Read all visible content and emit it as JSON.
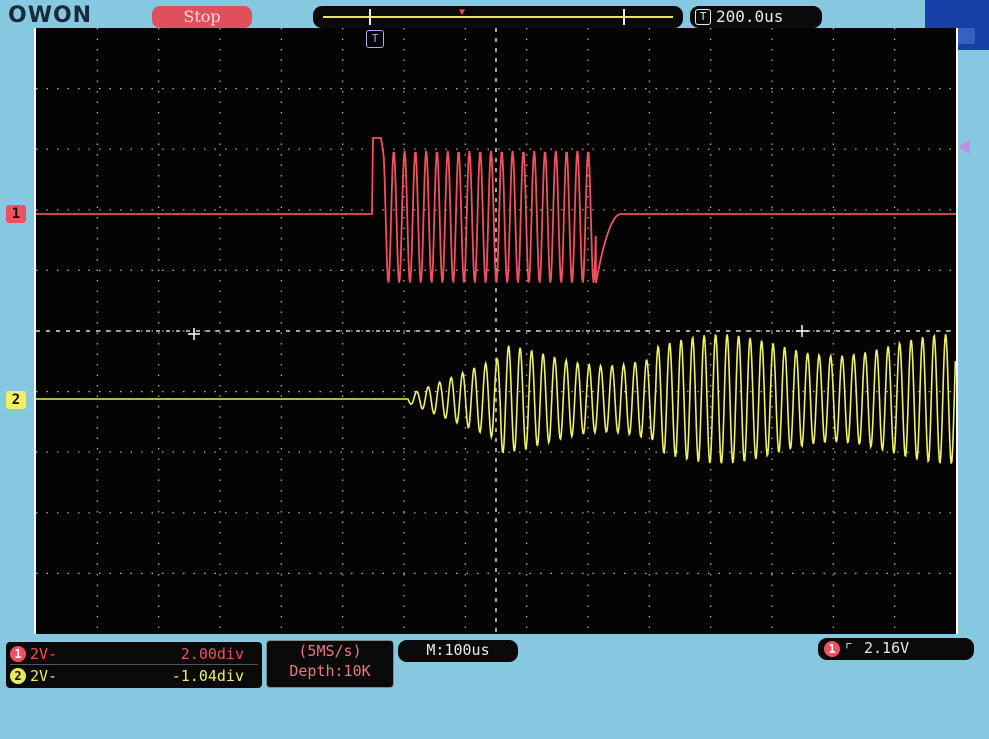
{
  "brand": {
    "logo_text": "OWON"
  },
  "acquisition": {
    "status": "Stop",
    "sample_rate": "(5MS/s)",
    "depth": "Depth:10K"
  },
  "timebase": {
    "icon": "T",
    "trigger_position": "200.0us",
    "main_timebase": "M:100us"
  },
  "channels": [
    {
      "id": "1",
      "volts_div": "2V-",
      "offset": "2.00div",
      "color": "#f05060"
    },
    {
      "id": "2",
      "volts_div": "2V-",
      "offset": "-1.04div",
      "color": "#f0f060"
    }
  ],
  "trigger": {
    "source": "1",
    "edge_icon": "rising-edge-icon",
    "level": "2.16V",
    "marker_label": "T"
  },
  "colors": {
    "background": "#86c8e0",
    "screen": "#040404",
    "ch1": "#f05060",
    "ch2": "#f0f060",
    "grid": "#d8d8d8"
  }
}
